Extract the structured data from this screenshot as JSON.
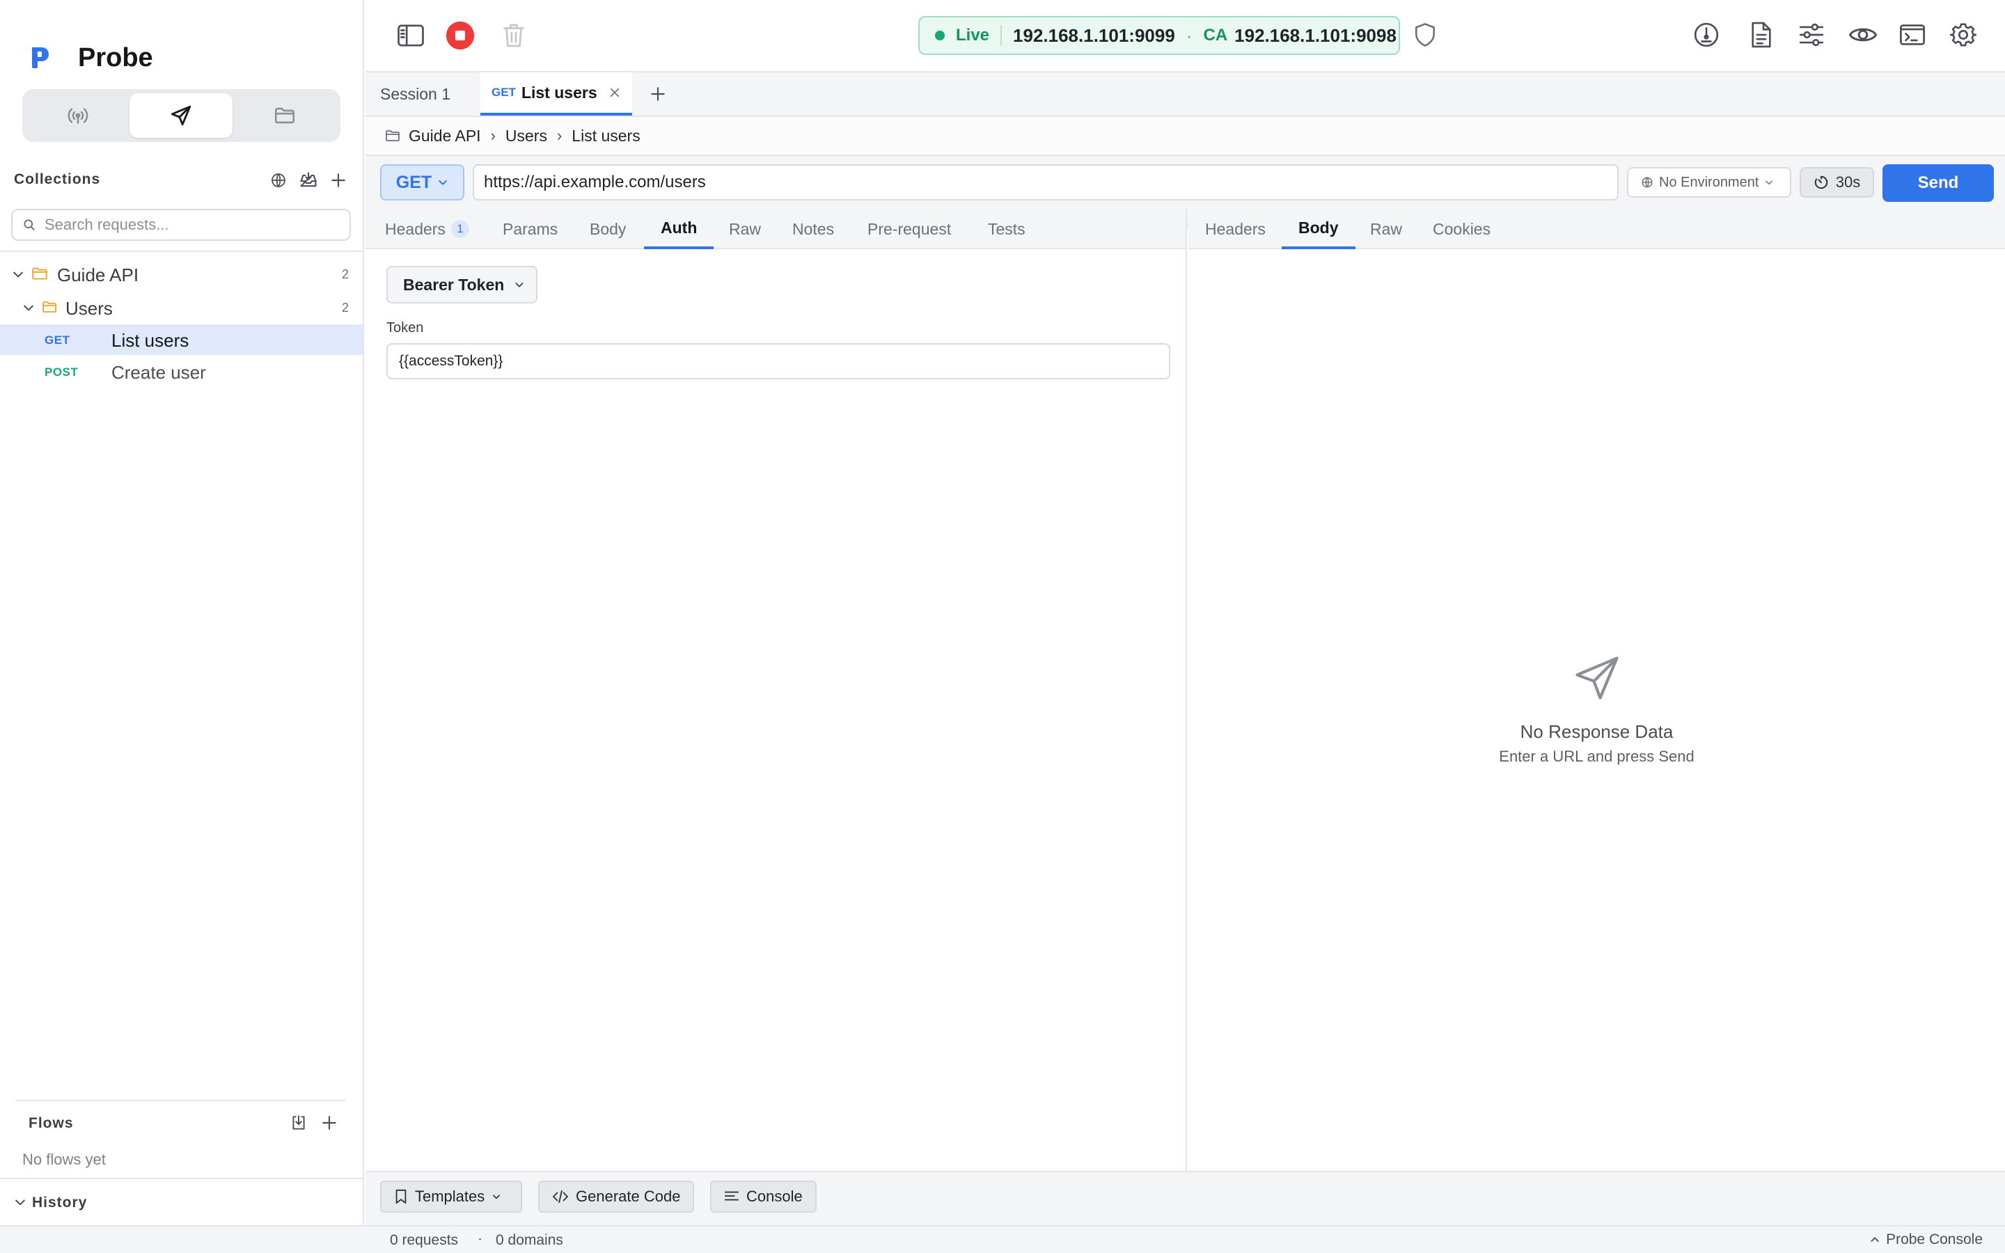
{
  "app": {
    "name": "Probe"
  },
  "sidebar": {
    "collections_title": "Collections",
    "search_placeholder": "Search requests...",
    "tree": {
      "collection": {
        "name": "Guide API",
        "count": "2"
      },
      "folder": {
        "name": "Users",
        "count": "2"
      },
      "requests": [
        {
          "method": "GET",
          "name": "List users",
          "method_color": "#2f74e8",
          "selected": true
        },
        {
          "method": "POST",
          "name": "Create user",
          "method_color": "#1aa872",
          "selected": false
        }
      ]
    },
    "flows_title": "Flows",
    "flows_empty": "No flows yet",
    "history_title": "History"
  },
  "topbar": {
    "live_label": "Live",
    "live_address": "192.168.1.101:9099",
    "ca_label": "CA",
    "ca_address": "192.168.1.101:9098",
    "separator_dot": "·"
  },
  "tabs": [
    {
      "label": "Session 1",
      "method": ""
    },
    {
      "label": "List users",
      "method": "GET"
    }
  ],
  "breadcrumb": [
    "Guide API",
    "Users",
    "List users"
  ],
  "request": {
    "method": "GET",
    "url": "https://api.example.com/users",
    "environment": "No Environment",
    "timeout": "30s",
    "send_label": "Send"
  },
  "request_tabs": [
    {
      "label": "Headers",
      "badge": "1"
    },
    {
      "label": "Params"
    },
    {
      "label": "Body"
    },
    {
      "label": "Auth",
      "active": true
    },
    {
      "label": "Raw"
    },
    {
      "label": "Notes"
    },
    {
      "label": "Pre-request"
    },
    {
      "label": "Tests"
    }
  ],
  "auth": {
    "type": "Bearer Token",
    "token_label": "Token",
    "token_value": "{{accessToken}}"
  },
  "response_tabs": [
    {
      "label": "Headers"
    },
    {
      "label": "Body",
      "active": true
    },
    {
      "label": "Raw"
    },
    {
      "label": "Cookies"
    }
  ],
  "response": {
    "empty_title": "No Response Data",
    "empty_subtitle": "Enter a URL and press Send"
  },
  "bottom_tools": {
    "templates": "Templates",
    "generate_code": "Generate Code",
    "console": "Console"
  },
  "status": {
    "requests": "0 requests",
    "separator": "·",
    "domains": "0 domains",
    "console_label": "Probe Console"
  },
  "colors": {
    "accent": "#2f74e8",
    "live_green": "#1aa872",
    "stop_red": "#f03a3a",
    "folder_orange": "#f0a320"
  }
}
